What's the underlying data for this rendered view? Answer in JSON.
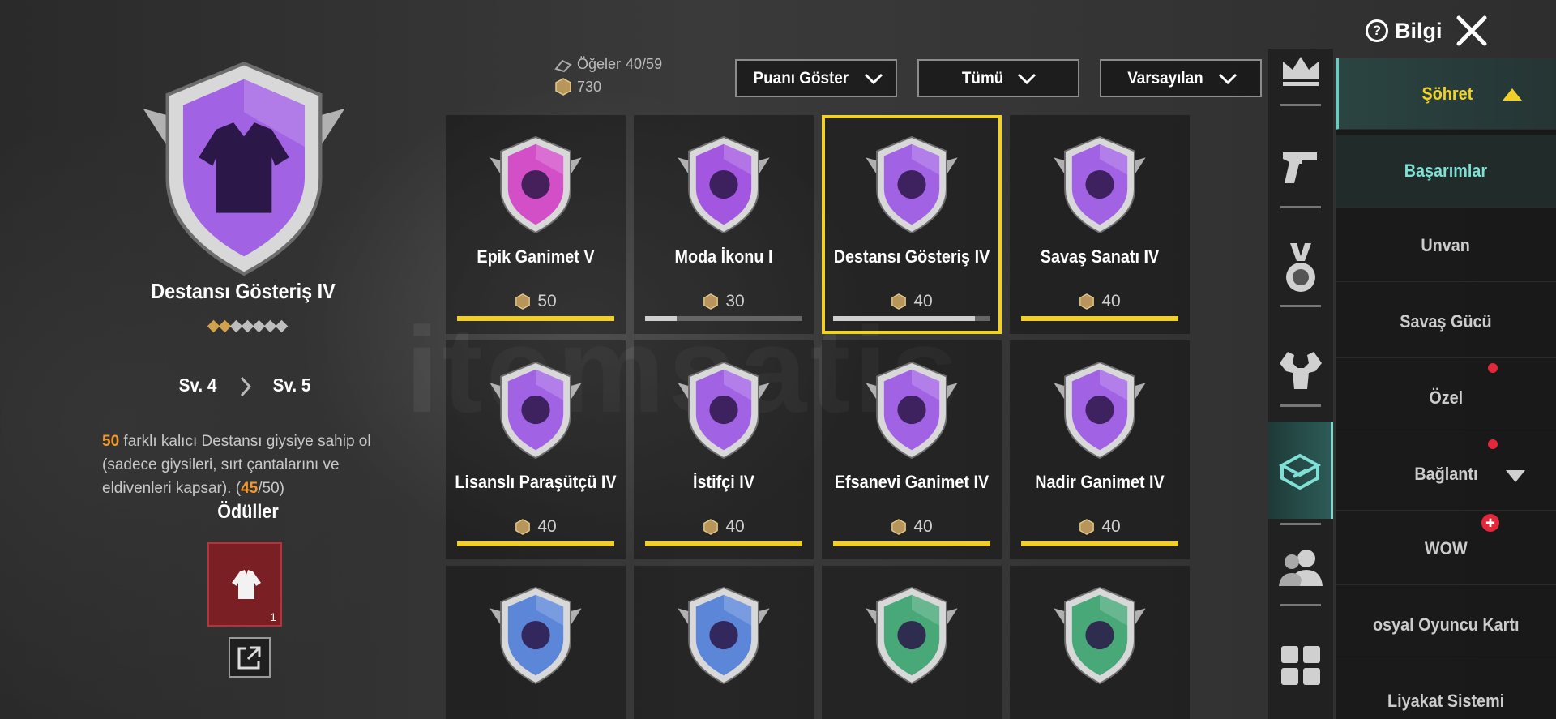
{
  "header": {
    "info_label": "Bilgi",
    "info_glyph": "?"
  },
  "selected_badge": {
    "name": "Destansı Gösteriş IV",
    "stars_filled": 2,
    "stars_total": 7,
    "level_current": "Sv. 4",
    "level_next": "Sv. 5",
    "desc_highlight": "50",
    "desc_text": " farklı kalıcı Destansı giysiye sahip ol (sadece giysileri, sırt çantalarını ve eldivenleri kapsar). (",
    "desc_progress": "45",
    "desc_total": "/50)",
    "rewards_title": "Ödüller",
    "reward_count": "1"
  },
  "stats": {
    "items_label": "Öğeler",
    "items_value": "40/59",
    "points": "730"
  },
  "filters": [
    {
      "label": "Puanı Göster"
    },
    {
      "label": "Tümü"
    },
    {
      "label": "Varsayılan"
    }
  ],
  "achievements": [
    {
      "title": "Epik Ganimet V",
      "points": "50",
      "progress": 1.0,
      "color": "#d34fc8"
    },
    {
      "title": "Moda İkonu I",
      "points": "30",
      "progress": 0.2,
      "color": "#a356e0"
    },
    {
      "title": "Destansı Gösteriş IV",
      "points": "40",
      "progress": 0.9,
      "color": "#a262e4"
    },
    {
      "title": "Savaş Sanatı IV",
      "points": "40",
      "progress": 1.0,
      "color": "#a262e4"
    },
    {
      "title": "Lisanslı Paraşütçü IV",
      "points": "40",
      "progress": 1.0,
      "color": "#a262e4"
    },
    {
      "title": "İstifçi IV",
      "points": "40",
      "progress": 1.0,
      "color": "#a262e4"
    },
    {
      "title": "Efsanevi Ganimet IV",
      "points": "40",
      "progress": 1.0,
      "color": "#a262e4"
    },
    {
      "title": "Nadir Ganimet IV",
      "points": "40",
      "progress": 1.0,
      "color": "#a262e4"
    },
    {
      "title": "",
      "points": "",
      "progress": null,
      "color": "#5c86d8"
    },
    {
      "title": "",
      "points": "",
      "progress": null,
      "color": "#5c86d8"
    },
    {
      "title": "",
      "points": "",
      "progress": null,
      "color": "#48a878"
    },
    {
      "title": "",
      "points": "",
      "progress": null,
      "color": "#48a878"
    }
  ],
  "menu": [
    {
      "label": "Şöhret",
      "state": "parent"
    },
    {
      "label": "Başarımlar",
      "state": "active"
    },
    {
      "label": "Unvan",
      "state": ""
    },
    {
      "label": "Savaş Gücü",
      "state": ""
    },
    {
      "label": "Özel",
      "state": "dot"
    },
    {
      "label": "Bağlantı",
      "state": "dot"
    },
    {
      "label": "WOW",
      "state": "gift"
    },
    {
      "label": "osyal Oyuncu Kartı",
      "state": ""
    },
    {
      "label": "Liyakat Sistemi",
      "state": ""
    }
  ],
  "side_icons": [
    "crown-icon",
    "pistol-icon",
    "medal-icon",
    "muscle-icon",
    "supply-crate-icon",
    "friends-icon",
    "grid-icon"
  ],
  "colors": {
    "accent_yellow": "#f1d129",
    "accent_teal": "#7fe0d6",
    "badge_purple": "#a262e4"
  }
}
